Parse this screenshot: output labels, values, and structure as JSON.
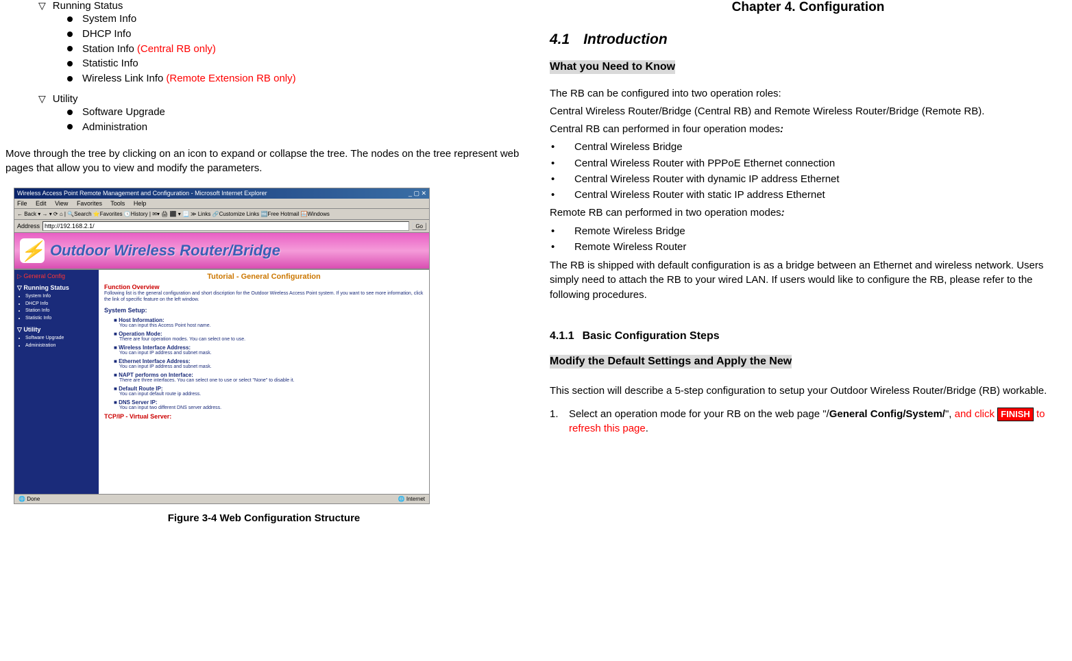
{
  "leftCol": {
    "treeGroups": [
      {
        "header": "Running Status",
        "items": [
          {
            "label": "System Info",
            "note": ""
          },
          {
            "label": "DHCP Info",
            "note": ""
          },
          {
            "label": "Station Info",
            "note": "(Central RB only)"
          },
          {
            "label": "Statistic Info",
            "note": ""
          },
          {
            "label": "Wireless Link Info",
            "note": "(Remote Extension RB only)"
          }
        ]
      },
      {
        "header": "Utility",
        "items": [
          {
            "label": "Software Upgrade",
            "note": ""
          },
          {
            "label": "Administration",
            "note": ""
          }
        ]
      }
    ],
    "para": "Move through the tree by clicking on an icon to expand or collapse the tree. The nodes on the tree represent web pages that allow you to view and modify the parameters.",
    "figCaption": "Figure 3-4  Web Configuration Structure",
    "ie": {
      "title": "Wireless Access Point Remote Management and Configuration - Microsoft Internet Explorer",
      "menus": [
        "File",
        "Edit",
        "View",
        "Favorites",
        "Tools",
        "Help"
      ],
      "toolbar": "← Back ▾  →  ▾  ⟳  ⌂  | 🔍Search  ⭐Favorites  🕒History | ✉▾  🖨  ⬛  ▾  📃  ≫  Links  🔗Customize Links  🆓Free Hotmail  🪟Windows",
      "addressLabel": "Address",
      "address": "http://192.168.2.1/",
      "goLabel": "Go",
      "bannerTitle": "Outdoor Wireless Router/Bridge",
      "sidebar": {
        "gc": "▷ General Config",
        "sec1": "▽ Running Status",
        "sec1items": [
          "System Info",
          "DHCP Info",
          "Station Info",
          "Statistic Info"
        ],
        "sec2": "▽ Utility",
        "sec2items": [
          "Software Upgrade",
          "Administration"
        ]
      },
      "main": {
        "ttitle": "Tutorial - General Configuration",
        "foTitle": "Function Overview",
        "foText": "Following list is the general configuration and short discription for the Outdoor Wireless Access Point system. If you want to see more information, click the link of specific feature on the left window.",
        "ssTitle": "System Setup:",
        "setupItems": [
          {
            "title": "Host Information:",
            "desc": "You can input this Access Point host name."
          },
          {
            "title": "Operation Mode:",
            "desc": "There are four operation modes. You can select one to use."
          },
          {
            "title": "Wireless Interface Address:",
            "desc": "You can input IP address and subnet mask."
          },
          {
            "title": "Ethernet Interface Address:",
            "desc": "You can input IP address and subnet mask."
          },
          {
            "title": "NAPT performs on Interface:",
            "desc": "There are three interfaces. You can select one to use or select \"None\" to disable it."
          },
          {
            "title": "Default Route IP:",
            "desc": "You can input default route ip address."
          },
          {
            "title": "DNS Server IP:",
            "desc": "You can input two different DNS server address."
          }
        ],
        "vsTitle": "TCP/IP - Virtual Server:"
      },
      "statusDone": "Done",
      "statusZone": "Internet"
    }
  },
  "rightCol": {
    "chapterTitle": "Chapter 4. Configuration",
    "secNum": "4.1",
    "secTitle": "Introduction",
    "sub1": "What you Need to Know",
    "p1": "The RB can be configured into two operation roles:",
    "p2": "Central Wireless Router/Bridge (Central RB) and Remote Wireless Router/Bridge (Remote RB).",
    "p3a": "Central RB can performed in four operation modes",
    "colon": ":",
    "centralModes": [
      "Central Wireless Bridge",
      "Central Wireless Router with PPPoE Ethernet connection",
      "Central Wireless Router with dynamic IP address Ethernet",
      "Central Wireless Router with static IP address Ethernet"
    ],
    "p4a": "Remote RB can performed in two operation modes",
    "remoteModes": [
      "Remote Wireless Bridge",
      "Remote Wireless Router"
    ],
    "p5": "The RB is shipped with default configuration is as a bridge between an Ethernet and wireless network. Users simply need to attach the RB to your wired LAN. If users would like to configure the RB, please refer to the following procedures.",
    "h411num": "4.1.1",
    "h411title": "Basic Configuration Steps",
    "sub2": "Modify the Default Settings and Apply the New",
    "p6": "This section will describe a 5-step configuration to setup your Outdoor Wireless Router/Bridge (RB) workable.",
    "step1": {
      "num": "1.",
      "textA": "Select an operation mode for your RB on the web page \"/",
      "path": "General Config/System/",
      "textB": "\", ",
      "red1": "and click ",
      "finish": "FINISH",
      "red2": " to refresh this page",
      "textC": "."
    }
  }
}
